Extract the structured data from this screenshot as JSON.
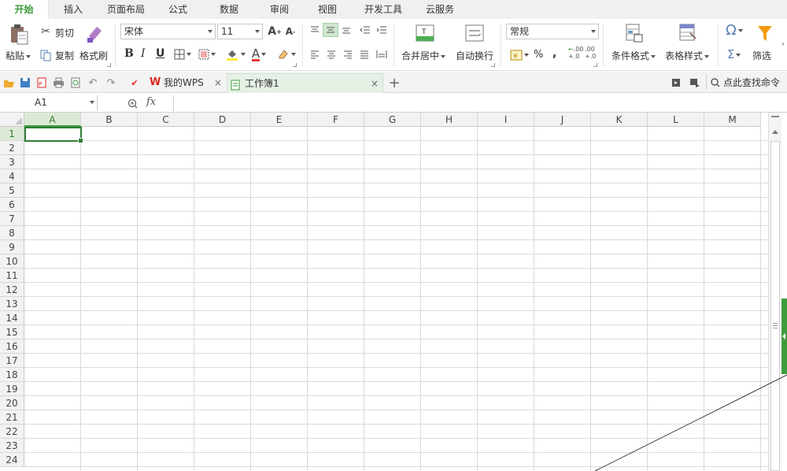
{
  "menu": {
    "tabs": [
      "开始",
      "插入",
      "页面布局",
      "公式",
      "数据",
      "审阅",
      "视图",
      "开发工具",
      "云服务"
    ],
    "active": 0
  },
  "ribbon": {
    "paste": "粘贴",
    "cut": "剪切",
    "copy": "复制",
    "format_painter": "格式刷",
    "font_name": "宋体",
    "font_size": "11",
    "bold": "B",
    "italic": "I",
    "underline": "U",
    "font_color_glyph": "A",
    "merge_center": "合并居中",
    "wrap_text": "自动换行",
    "number_format": "常规",
    "percent": "%",
    "comma": ",",
    "inc_decimal": ".00",
    "dec_decimal": ".00",
    "conditional_format": "条件格式",
    "table_style": "表格样式",
    "filter": "筛选",
    "symbol_glyph": "Ω",
    "sum_glyph": "Σ"
  },
  "doc_tabs": {
    "wps_tab": "我的WPS",
    "workbook_tab": "工作簿1",
    "search_commands": "点此查找命令"
  },
  "formula_bar": {
    "name_box": "A1",
    "fx": "fx",
    "value": ""
  },
  "sheet": {
    "columns": [
      "A",
      "B",
      "C",
      "D",
      "E",
      "F",
      "G",
      "H",
      "I",
      "J",
      "K",
      "L",
      "M"
    ],
    "rows": [
      "1",
      "2",
      "3",
      "4",
      "5",
      "6",
      "7",
      "8",
      "9",
      "10",
      "11",
      "12",
      "13",
      "14",
      "15",
      "16",
      "17",
      "18",
      "19",
      "20",
      "21",
      "22",
      "23",
      "24"
    ],
    "active_cell": "A1"
  },
  "colors": {
    "accent_green": "#3b9a3b",
    "active_cell_border": "#2e7d32",
    "wps_red": "#d9281f"
  }
}
